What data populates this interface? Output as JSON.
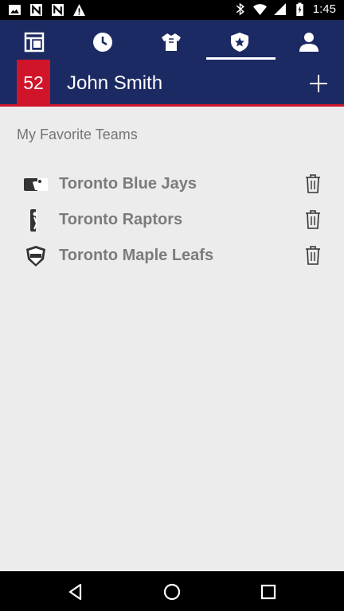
{
  "status_bar": {
    "time": "1:45",
    "left_icons": [
      "image-icon",
      "n-notification-icon",
      "n-notification-icon",
      "warning-icon"
    ],
    "right_icons": [
      "bluetooth-icon",
      "wifi-icon",
      "signal-icon",
      "battery-icon"
    ]
  },
  "nav_tabs": [
    {
      "name": "layout-icon"
    },
    {
      "name": "clock-icon"
    },
    {
      "name": "jersey-icon"
    },
    {
      "name": "shield-star-icon",
      "active": true
    },
    {
      "name": "person-icon"
    }
  ],
  "user": {
    "badge_number": "52",
    "name": "John Smith"
  },
  "favorites": {
    "title": "My Favorite Teams",
    "teams": [
      {
        "name": "Toronto Blue Jays",
        "league_icon": "mlb-logo-icon"
      },
      {
        "name": "Toronto Raptors",
        "league_icon": "nba-logo-icon"
      },
      {
        "name": "Toronto Maple Leafs",
        "league_icon": "nhl-logo-icon"
      }
    ]
  },
  "colors": {
    "header_bg": "#1c2a63",
    "accent_red": "#d0152b",
    "content_bg": "#ececec",
    "team_text": "#7b7b7b"
  }
}
